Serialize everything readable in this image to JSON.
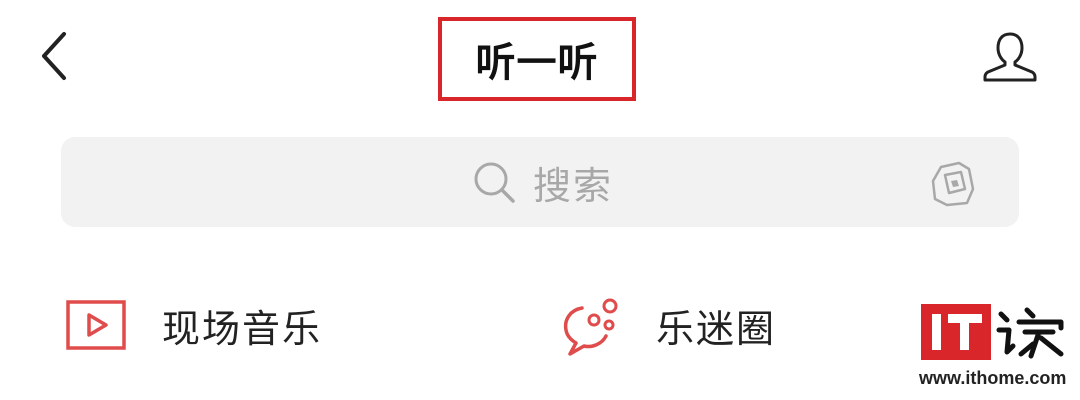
{
  "header": {
    "title": "听一听",
    "back_icon": "chevron-left-icon",
    "profile_icon": "user-icon"
  },
  "search": {
    "placeholder": "搜索",
    "search_icon": "search-icon",
    "scan_icon": "scan-icon"
  },
  "categories": [
    {
      "label": "现场音乐",
      "icon": "play-video-icon"
    },
    {
      "label": "乐迷圈",
      "icon": "chat-bubble-icon"
    }
  ],
  "watermark": {
    "url": "www.ithome.com",
    "logo_text": "IT之家"
  },
  "colors": {
    "accent": "#e04b4b",
    "highlight_border": "#d9262a",
    "search_bg": "#f2f2f2",
    "placeholder": "#a8a8a8"
  }
}
